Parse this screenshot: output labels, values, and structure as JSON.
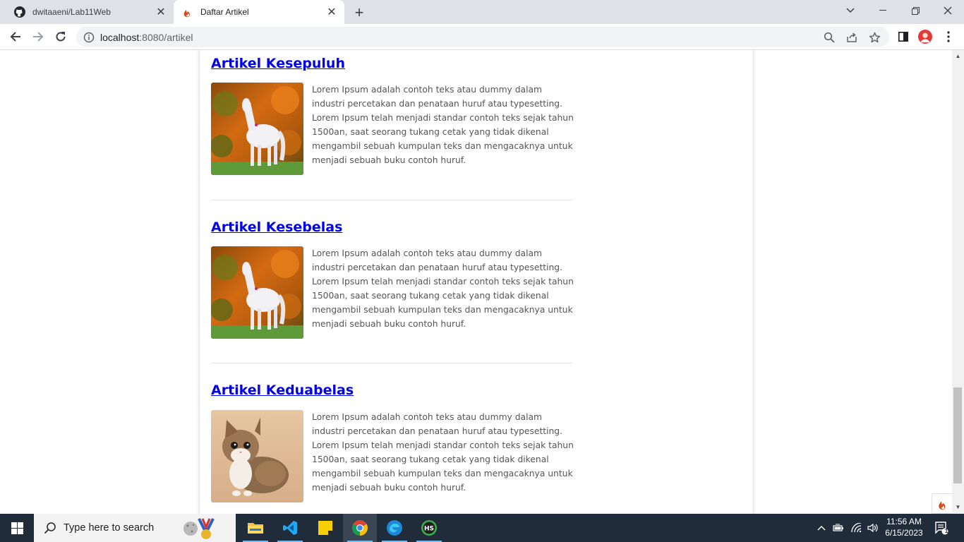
{
  "browser": {
    "tabs": [
      {
        "title": "dwitaaeni/Lab11Web",
        "icon": "github-icon"
      },
      {
        "title": "Daftar Artikel",
        "icon": "codeigniter-icon"
      }
    ],
    "url_host": "localhost",
    "url_rest": ":8080/artikel"
  },
  "articles": [
    {
      "title": "Artikel Kesepuluh",
      "image": "horse-photo",
      "body": "Lorem Ipsum adalah contoh teks atau dummy dalam industri percetakan dan penataan huruf atau typesetting. Lorem Ipsum telah menjadi standar contoh teks sejak tahun 1500an, saat seorang tukang cetak yang tidak dikenal mengambil sebuah kumpulan teks dan mengacaknya untuk menjadi sebuah buku contoh huruf."
    },
    {
      "title": "Artikel Kesebelas",
      "image": "horse-photo",
      "body": "Lorem Ipsum adalah contoh teks atau dummy dalam industri percetakan dan penataan huruf atau typesetting. Lorem Ipsum telah menjadi standar contoh teks sejak tahun 1500an, saat seorang tukang cetak yang tidak dikenal mengambil sebuah kumpulan teks dan mengacaknya untuk menjadi sebuah buku contoh huruf."
    },
    {
      "title": "Artikel Keduabelas",
      "image": "kitten-photo",
      "body": "Lorem Ipsum adalah contoh teks atau dummy dalam industri percetakan dan penataan huruf atau typesetting. Lorem Ipsum telah menjadi standar contoh teks sejak tahun 1500an, saat seorang tukang cetak yang tidak dikenal mengambil sebuah kumpulan teks dan mengacaknya untuk menjadi sebuah buku contoh huruf."
    }
  ],
  "taskbar": {
    "search_placeholder": "Type here to search",
    "time": "11:56 AM",
    "date": "6/15/2023",
    "notification_count": "1"
  },
  "colors": {
    "link": "#0000ee",
    "taskbar": "#202c3a",
    "tabbar": "#dee1e6"
  }
}
